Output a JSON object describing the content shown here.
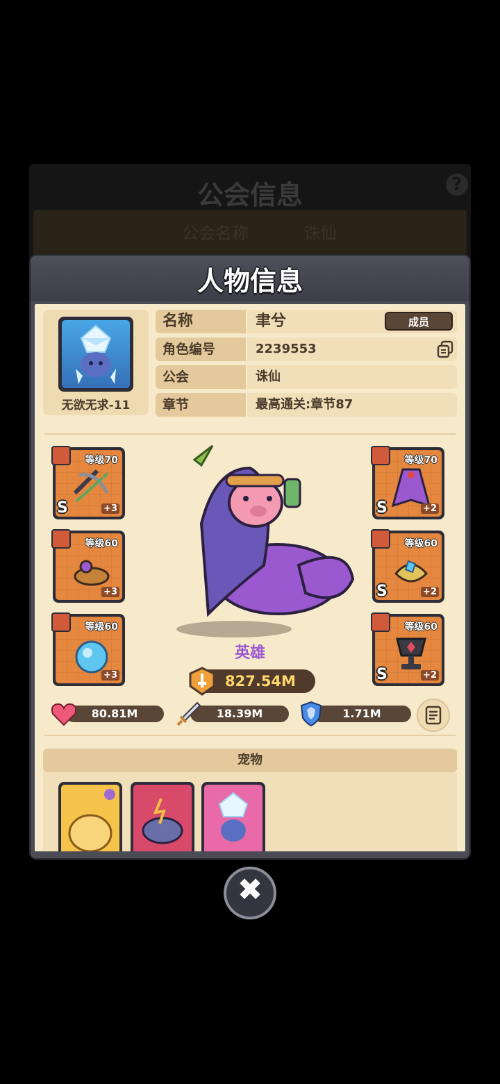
{
  "background_panel": {
    "title": "公会信息",
    "row_label": "公会名称",
    "row_value": "诛仙"
  },
  "modal": {
    "title": "人物信息"
  },
  "profile": {
    "avatar_name": "无欲无求-11",
    "rows": [
      {
        "label": "名称",
        "value": "聿兮",
        "badge": "成员"
      },
      {
        "label": "角色编号",
        "value": "2239553"
      },
      {
        "label": "公会",
        "value": "诛仙"
      },
      {
        "label": "章节",
        "value": "最高通关:章节87"
      }
    ]
  },
  "equipment": {
    "left": [
      {
        "name": "crossbow",
        "level": "等级70",
        "plus": "+3",
        "grade": "S",
        "color": "#e5873e"
      },
      {
        "name": "ring",
        "level": "等级60",
        "plus": "+3",
        "grade": "",
        "color": "#e5873e"
      },
      {
        "name": "orb",
        "level": "等级60",
        "plus": "+3",
        "grade": "",
        "color": "#e5873e"
      }
    ],
    "right": [
      {
        "name": "cloak",
        "level": "等级70",
        "plus": "+2",
        "grade": "S",
        "color": "#e5873e"
      },
      {
        "name": "bracelet",
        "level": "等级60",
        "plus": "+2",
        "grade": "S",
        "color": "#e5873e"
      },
      {
        "name": "trophy",
        "level": "等级60",
        "plus": "+2",
        "grade": "S",
        "color": "#e5873e"
      }
    ]
  },
  "hero": {
    "title": "英雄",
    "power": "827.54M"
  },
  "stats": {
    "hp": "80.81M",
    "attack": "18.39M",
    "defense": "1.71M"
  },
  "pets": {
    "header": "宠物"
  }
}
